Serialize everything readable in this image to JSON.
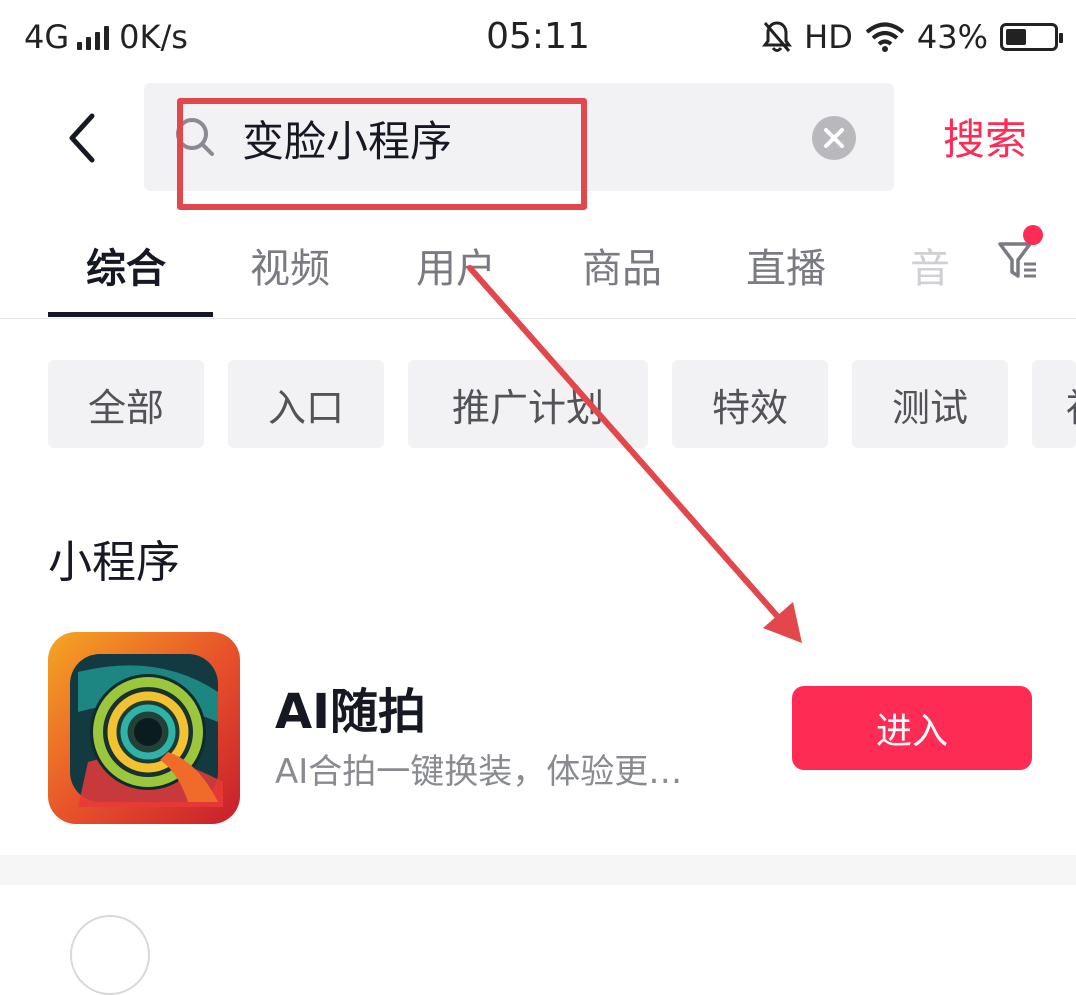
{
  "status_bar": {
    "network": "4G",
    "speed": "0K/s",
    "time": "05:11",
    "hd": "HD",
    "battery_text": "43%",
    "battery_level": 0.43,
    "icons": [
      "signal-icon",
      "mute-bell-icon",
      "wifi-icon",
      "battery-icon"
    ]
  },
  "search": {
    "query": "变脸小程序",
    "button_label": "搜索",
    "icons": [
      "back-icon",
      "search-icon",
      "clear-icon"
    ]
  },
  "tabs": [
    {
      "label": "综合",
      "active": true
    },
    {
      "label": "视频",
      "active": false
    },
    {
      "label": "用户",
      "active": false
    },
    {
      "label": "商品",
      "active": false
    },
    {
      "label": "直播",
      "active": false
    },
    {
      "label": "音",
      "active": false
    }
  ],
  "filter": {
    "icon": "filter-icon",
    "badge": true
  },
  "chips": [
    "全部",
    "入口",
    "推广计划",
    "特效",
    "测试",
    "社"
  ],
  "section": {
    "title": "小程序",
    "app": {
      "name": "AI随拍",
      "description": "AI合拍一键换装，体验更…",
      "button_label": "进入",
      "icon": "camera-lens-icon"
    }
  },
  "colors": {
    "accent": "#fe2c55",
    "annotation": "#e2484b",
    "text_primary": "#161823",
    "text_secondary": "#7a7b82",
    "chip_bg": "#f2f2f4"
  }
}
